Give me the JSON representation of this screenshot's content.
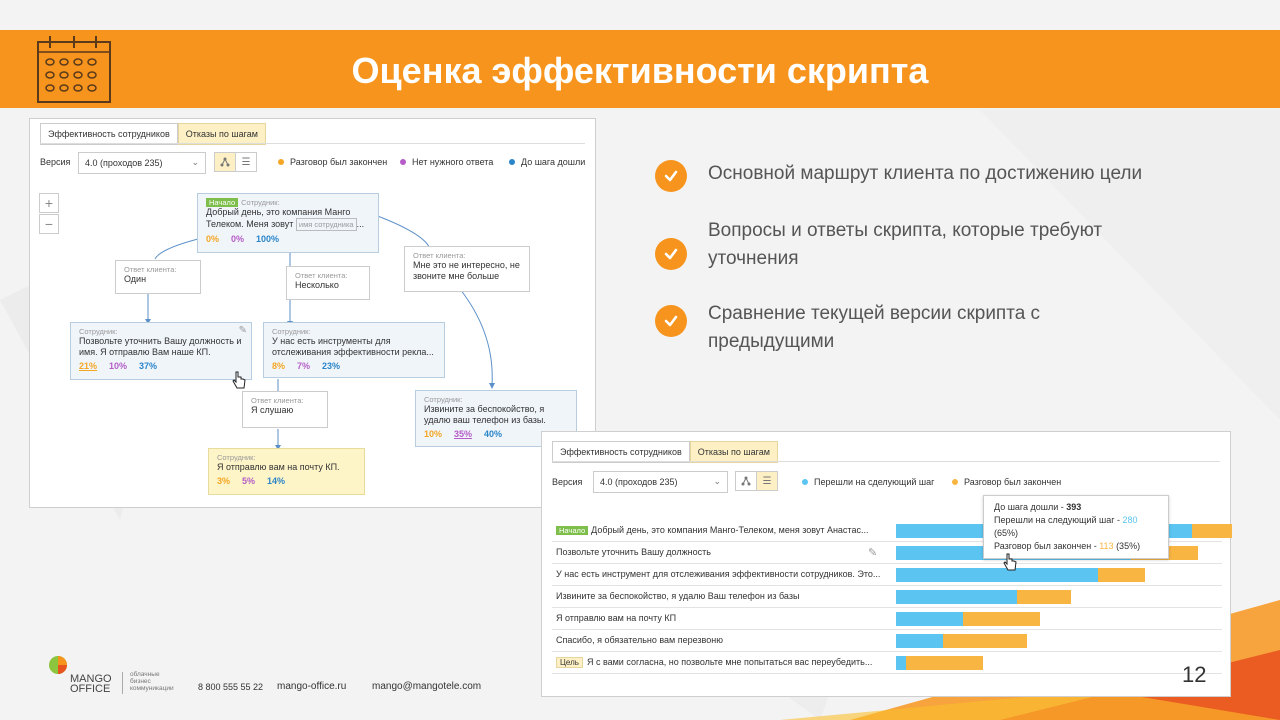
{
  "header": {
    "title": "Оценка эффективности скрипта"
  },
  "panel1": {
    "tabs": [
      "Эффективность сотрудников",
      "Отказы по шагам"
    ],
    "version_label": "Версия",
    "version_value": "4.0 (проходов 235)",
    "legend": [
      {
        "label": "Разговор был закончен",
        "color": "#f5a623"
      },
      {
        "label": "Нет нужного ответа",
        "color": "#b55cc7"
      },
      {
        "label": "До шага дошли",
        "color": "#2a85c9"
      }
    ],
    "zoom_in": "+",
    "zoom_out": "−",
    "nodes": {
      "start": {
        "badge": "Начало",
        "label": "Сотрудник:",
        "text": "Добрый день, это компания Манго Телеком. Меня зовут",
        "placeholder": "имя сотрудника",
        "ellipsis": "...",
        "p1": "0%",
        "p2": "0%",
        "p3": "100%"
      },
      "ans_one": {
        "label": "Ответ клиента:",
        "text": "Один"
      },
      "ans_several": {
        "label": "Ответ клиента:",
        "text": "Несколько"
      },
      "ans_noint": {
        "label": "Ответ клиента:",
        "text": "Мне это не интересно, не звоните мне больше"
      },
      "emp_position": {
        "label": "Сотрудник:",
        "text": "Позвольте уточнить Вашу должность и имя. Я отправлю Вам наше КП.",
        "p1": "21%",
        "p2": "10%",
        "p3": "37%"
      },
      "emp_tools": {
        "label": "Сотрудник:",
        "text": "У нас есть инструменты для отслеживания эффективности рекла...",
        "p1": "8%",
        "p2": "7%",
        "p3": "23%"
      },
      "emp_sorry": {
        "label": "Сотрудник:",
        "text": "Извините за беспокойство, я удалю ваш телефон из базы.",
        "p1": "10%",
        "p2": "35%",
        "p3": "40%"
      },
      "ans_listen": {
        "label": "Ответ клиента:",
        "text": "Я слушаю"
      },
      "emp_mail": {
        "label": "Сотрудник:",
        "text": "Я отправлю вам на почту КП.",
        "p1": "3%",
        "p2": "5%",
        "p3": "14%"
      }
    }
  },
  "panel2": {
    "tabs": [
      "Эффективность сотрудников",
      "Отказы по шагам"
    ],
    "version_label": "Версия",
    "version_value": "4.0 (проходов 235)",
    "legend": [
      {
        "label": "Перешли на сделующий шаг",
        "color": "#5bc4f1"
      },
      {
        "label": "Разговор был закончен",
        "color": "#f9b542"
      }
    ],
    "rows": [
      {
        "badge": "Начало",
        "text": "Добрый день, это компания Манго-Телеком, меня зовут Анастас...",
        "blue": 0.88,
        "orange": 0.12
      },
      {
        "badge": "",
        "text": "Позвольте уточнить Вашу должность",
        "blue": 0.7,
        "orange": 0.2
      },
      {
        "badge": "",
        "text": "У нас есть инструмент для отслеживания эффективности сотрудников. Это...",
        "blue": 0.6,
        "orange": 0.14
      },
      {
        "badge": "",
        "text": "Извините за беспокойство, я удалю Ваш телефон из базы",
        "blue": 0.36,
        "orange": 0.16
      },
      {
        "badge": "",
        "text": "Я отправлю вам на почту КП",
        "blue": 0.2,
        "orange": 0.23
      },
      {
        "badge": "",
        "text": "Спасибо, я обязательно вам перезвоню",
        "blue": 0.14,
        "orange": 0.25
      },
      {
        "badge": "Цель",
        "text": "Я с вами согласна, но позвольте мне попытаться вас переубедить...",
        "blue": 0.03,
        "orange": 0.23
      }
    ],
    "tooltip": {
      "reached_label": "До шага дошли - ",
      "reached_value": "393",
      "next_label": "Перешли на следующий шаг - ",
      "next_value": "280",
      "next_pct": " (65%)",
      "ended_label": "Разговор был закончен - ",
      "ended_value": "113",
      "ended_pct": " (35%)"
    }
  },
  "bullets": [
    "Основной маршрут клиента по достижению цели",
    "Вопросы и ответы скрипта, которые требуют уточнения",
    "Сравнение текущей версии скрипта с предыдущими"
  ],
  "footer": {
    "brand1": "MANGO",
    "brand2": "OFFICE",
    "tagline": [
      "облачные",
      "бизнес",
      "коммуникации"
    ],
    "phone": "8 800 555 55 22",
    "site": "mango-office.ru",
    "email": "mango@mangotele.com"
  },
  "page_number": "12"
}
